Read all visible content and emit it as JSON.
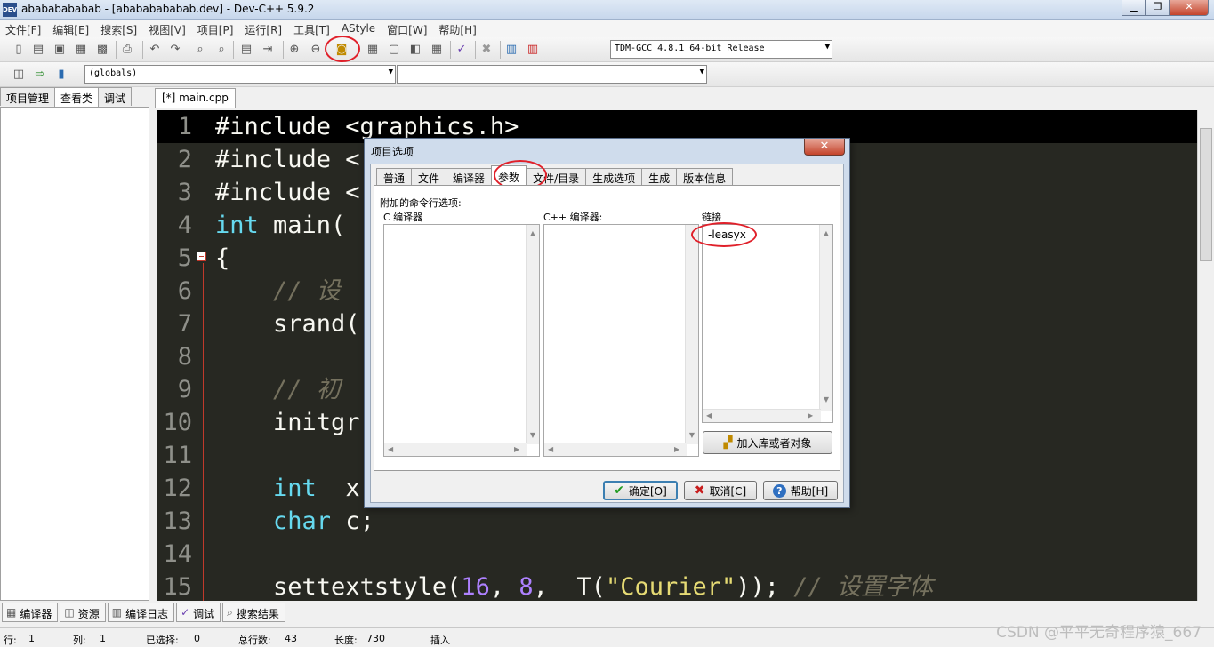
{
  "window": {
    "title": "abababababab - [abababababab.dev] - Dev-C++ 5.9.2",
    "app_icon": "DEV",
    "minimize": "▁",
    "maximize": "❐",
    "close": "✕"
  },
  "menu": [
    "文件[F]",
    "编辑[E]",
    "搜索[S]",
    "视图[V]",
    "项目[P]",
    "运行[R]",
    "工具[T]",
    "AStyle",
    "窗口[W]",
    "帮助[H]"
  ],
  "toolbar": {
    "compiler_select": "TDM-GCC 4.8.1 64-bit Release",
    "scope_select": "(globals)",
    "member_select": ""
  },
  "left_tabs": [
    "项目管理",
    "查看类",
    "调试"
  ],
  "editor": {
    "tab_label": "[*] main.cpp",
    "lines": {
      "l1": {
        "n": "1",
        "pre": "#include <graphics.h>"
      },
      "l2": {
        "n": "2",
        "pre": "#include <"
      },
      "l3": {
        "n": "3",
        "pre": "#include <"
      },
      "l4": {
        "n": "4",
        "kw": "int",
        "rest": " main("
      },
      "l5": {
        "n": "5",
        "pre": "{"
      },
      "l6": {
        "n": "6",
        "cmt": "// 设"
      },
      "l7": {
        "n": "7",
        "pre": "srand("
      },
      "l8": {
        "n": "8",
        "pre": ""
      },
      "l9": {
        "n": "9",
        "cmt": "// 初"
      },
      "l10": {
        "n": "10",
        "pre": "initgr"
      },
      "l11": {
        "n": "11",
        "pre": ""
      },
      "l12": {
        "n": "12",
        "kw": "int",
        "rest": "  x"
      },
      "l13": {
        "n": "13",
        "kw": "char",
        "rest": " c;"
      },
      "l14": {
        "n": "14",
        "pre": ""
      },
      "l15": {
        "n": "15",
        "fn": "settextstyle(",
        "n1": "16",
        "c1": ", ",
        "n2": "8",
        "c2": ",  T(",
        "str": "\"Courier\"",
        "c3": ")); ",
        "cmt": "// 设置字体"
      }
    }
  },
  "dialog": {
    "title": "项目选项",
    "close": "✕",
    "tabs": [
      "普通",
      "文件",
      "编译器",
      "参数",
      "文件/目录",
      "生成选项",
      "生成",
      "版本信息"
    ],
    "section_label": "附加的命令行选项:",
    "c_compiler_label": "C 编译器",
    "cpp_compiler_label": "C++ 编译器:",
    "linker_label": "链接",
    "linker_value": "-leasyx",
    "add_lib_button": "加入库或者对象",
    "ok_button": "确定[O]",
    "cancel_button": "取消[C]",
    "help_button": "帮助[H]"
  },
  "bottom_tabs": [
    "编译器",
    "资源",
    "编译日志",
    "调试",
    "搜索结果"
  ],
  "status": {
    "row_label": "行:",
    "row_value": "1",
    "col_label": "列:",
    "col_value": "1",
    "sel_label": "已选择:",
    "sel_value": "0",
    "lines_label": "总行数:",
    "lines_value": "43",
    "len_label": "长度:",
    "len_value": "730",
    "mode": "插入"
  },
  "watermark": "CSDN @平平无奇程序猿_667",
  "colors": {
    "editor_bg": "#272822",
    "keyword": "#66d9ef",
    "number": "#ae81ff",
    "string": "#e6db74",
    "comment": "#75715e",
    "annotation_red": "#e0202a"
  }
}
